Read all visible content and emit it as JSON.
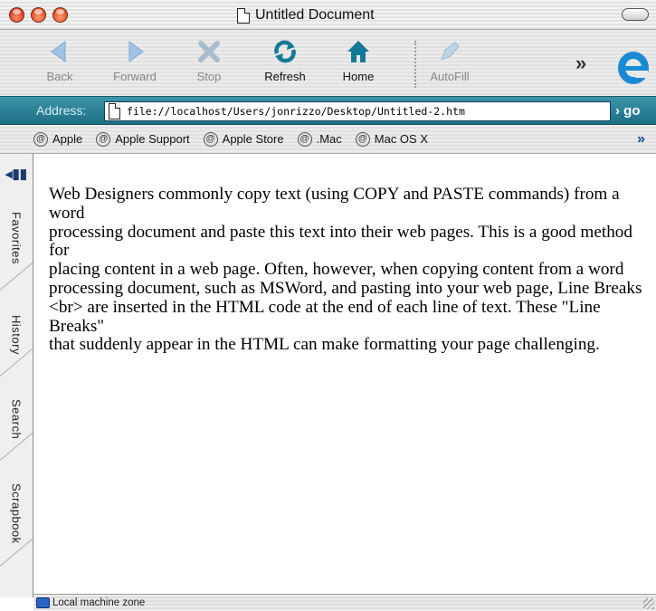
{
  "window": {
    "title": "Untitled Document"
  },
  "toolbar": {
    "back_label": "Back",
    "forward_label": "Forward",
    "stop_label": "Stop",
    "refresh_label": "Refresh",
    "home_label": "Home",
    "autofill_label": "AutoFill",
    "more_label": "»"
  },
  "address": {
    "label": "Address:",
    "url": "file://localhost/Users/jonrizzo/Desktop/Untitled-2.htm",
    "go_label": "› go"
  },
  "favorites": {
    "items": [
      {
        "label": "Apple"
      },
      {
        "label": "Apple Support"
      },
      {
        "label": "Apple Store"
      },
      {
        "label": ".Mac"
      },
      {
        "label": "Mac OS X"
      }
    ],
    "more_label": "»"
  },
  "sidebar": {
    "tabs": [
      {
        "label": "Favorites"
      },
      {
        "label": "History"
      },
      {
        "label": "Search"
      },
      {
        "label": "Scrapbook"
      }
    ]
  },
  "content": {
    "lines": [
      "Web Designers commonly copy text (using COPY and PASTE commands) from a word",
      "processing document and paste this text into their web pages. This is a good method for",
      "placing content in a web page. Often, however, when copying content from a word",
      "processing document, such as MSWord, and pasting into your web page, Line Breaks",
      "<br> are inserted in the HTML code at the end of each line of text. These \"Line Breaks\"",
      "that suddenly appear in the HTML can make formatting your page challenging."
    ]
  },
  "status": {
    "zone": "Local machine zone"
  },
  "colors": {
    "address_bar": "#2a8197",
    "ie_logo": "#1a8ad4"
  }
}
